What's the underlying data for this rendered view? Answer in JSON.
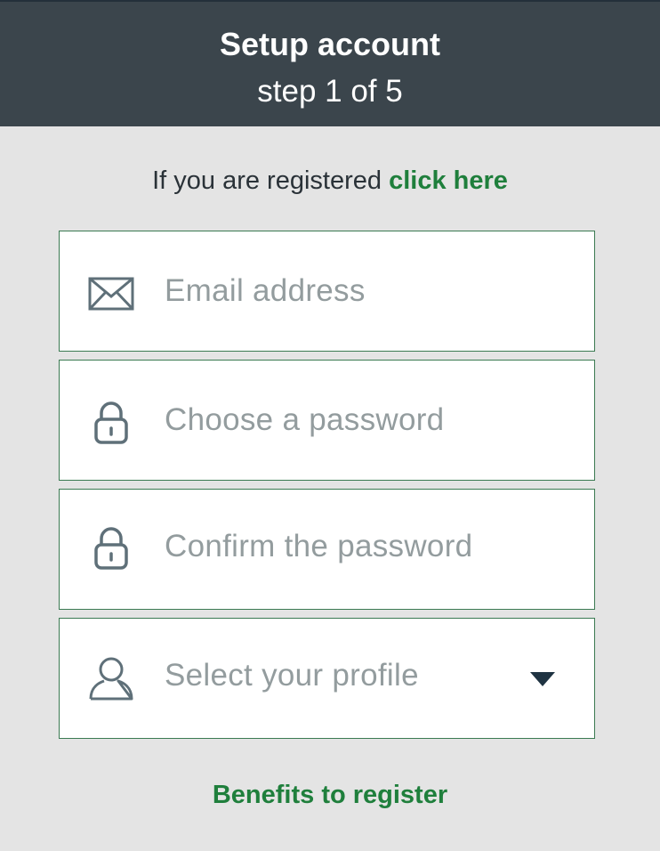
{
  "header": {
    "title": "Setup account",
    "step": "step 1 of 5"
  },
  "login_prompt": {
    "text": "If you are registered ",
    "link": "click here"
  },
  "form": {
    "email": {
      "placeholder": "Email address",
      "icon": "envelope-icon"
    },
    "password": {
      "placeholder": "Choose a password",
      "icon": "lock-icon"
    },
    "confirm_password": {
      "placeholder": "Confirm the password",
      "icon": "lock-icon"
    },
    "profile": {
      "placeholder": "Select your profile",
      "icon": "user-icon",
      "arrow_icon": "caret-down-icon"
    }
  },
  "footer": {
    "benefits_link": "Benefits to register"
  },
  "colors": {
    "header_bg": "#3b454c",
    "page_bg": "#e4e4e4",
    "accent_green": "#1f7f3c",
    "field_border": "#3b7a52",
    "icon_color": "#5f7079",
    "placeholder": "#939c9e"
  }
}
